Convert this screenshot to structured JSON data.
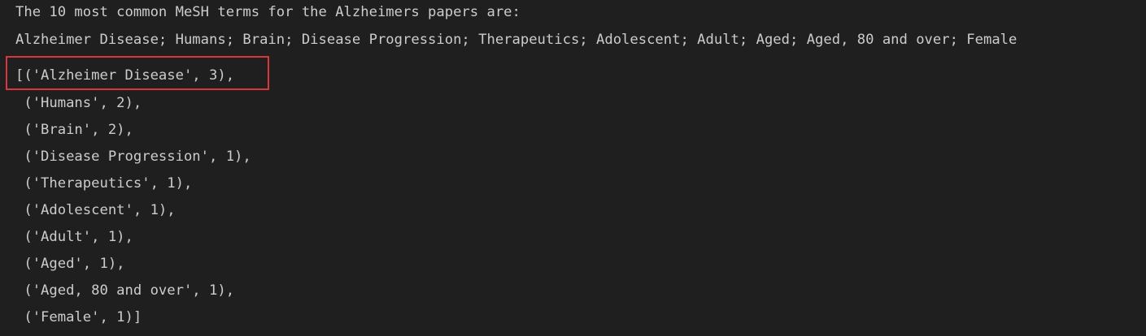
{
  "output": {
    "heading": "The 10 most common MeSH terms for the Alzheimers papers are:",
    "terms_line": "Alzheimer Disease; Humans; Brain; Disease Progression; Therapeutics; Adolescent; Adult; Aged; Aged, 80 and over; Female",
    "result_lines": [
      "[('Alzheimer Disease', 3),",
      " ('Humans', 2),",
      " ('Brain', 2),",
      " ('Disease Progression', 1),",
      " ('Therapeutics', 1),",
      " ('Adolescent', 1),",
      " ('Adult', 1),",
      " ('Aged', 1),",
      " ('Aged, 80 and over', 1),",
      " ('Female', 1)]"
    ]
  },
  "colors": {
    "background": "#1f1f1f",
    "text": "#cccccc",
    "highlight_border": "#d9363e"
  }
}
